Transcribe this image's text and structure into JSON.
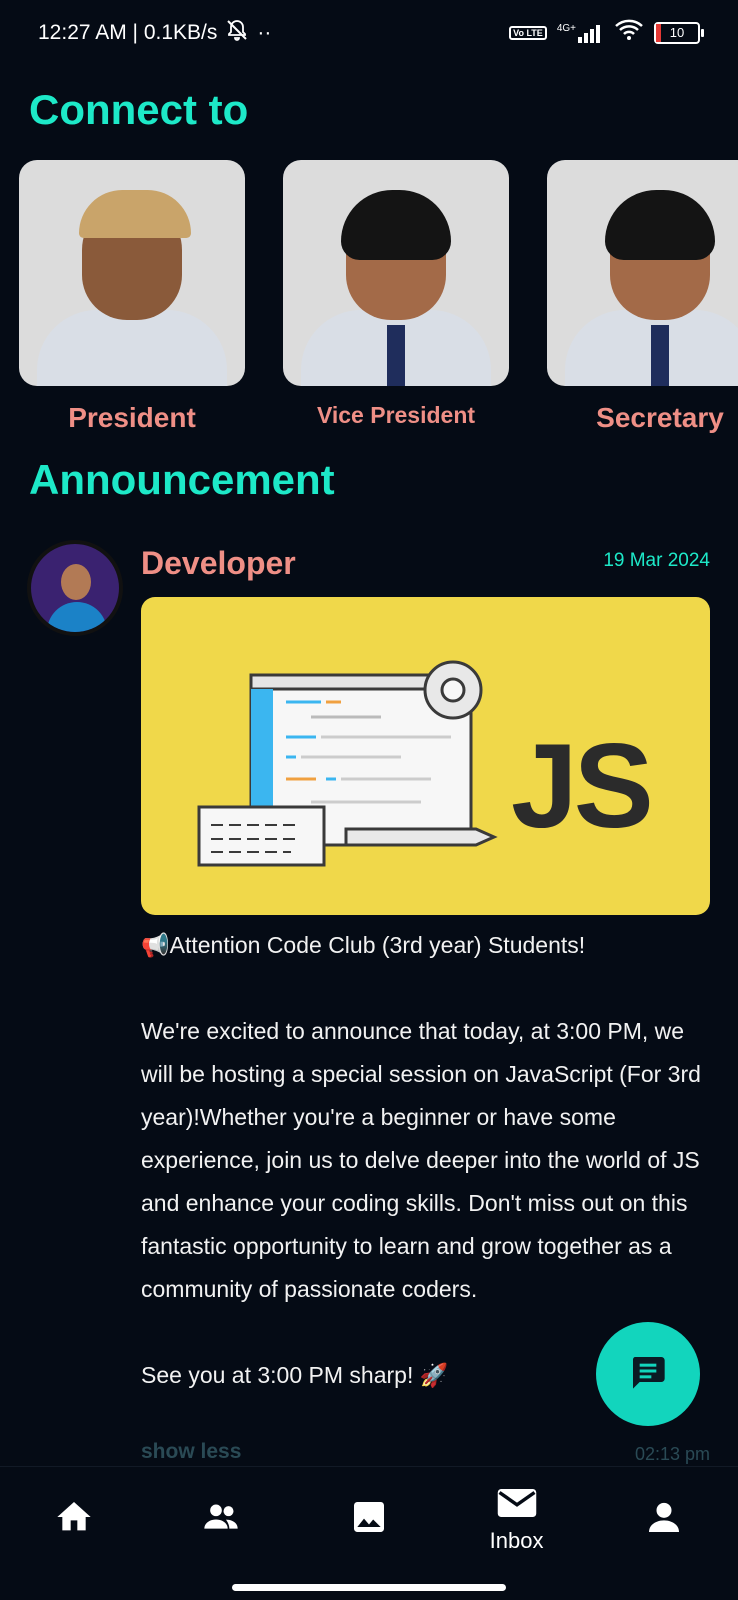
{
  "status_bar": {
    "time_speed": "12:27 AM | 0.1KB/s",
    "dots": "··",
    "volte": "Vo LTE",
    "network": "4G+",
    "battery": "10"
  },
  "connect": {
    "title": "Connect to",
    "leaders": [
      {
        "role": "President"
      },
      {
        "role": "Vice President"
      },
      {
        "role": "Secretary"
      }
    ]
  },
  "announcement": {
    "title": "Announcement",
    "post": {
      "author": "Developer",
      "date": "19 Mar 2024",
      "banner_text": "JS",
      "headline": "📢Attention Code Club (3rd year) Students!",
      "body": "We're excited to announce that today, at 3:00 PM, we will be hosting a special session on JavaScript (For 3rd year)!Whether you're a beginner or have some experience, join us to delve deeper into the world of JS and enhance your coding skills. Don't miss out on this fantastic opportunity to learn and grow together as a community of passionate coders.",
      "closing": "See you at 3:00 PM sharp! 🚀",
      "show_less": "show less",
      "time": "02:13 pm"
    }
  },
  "bottom_nav": {
    "items": [
      {
        "icon": "home-icon",
        "label": ""
      },
      {
        "icon": "people-icon",
        "label": ""
      },
      {
        "icon": "image-icon",
        "label": ""
      },
      {
        "icon": "mail-icon",
        "label": "Inbox"
      },
      {
        "icon": "person-icon",
        "label": ""
      }
    ]
  },
  "colors": {
    "accent": "#1de9c8",
    "name_color": "#ef8f86",
    "background": "#050b15",
    "banner": "#f0d84a",
    "fab": "#12d5bd"
  }
}
